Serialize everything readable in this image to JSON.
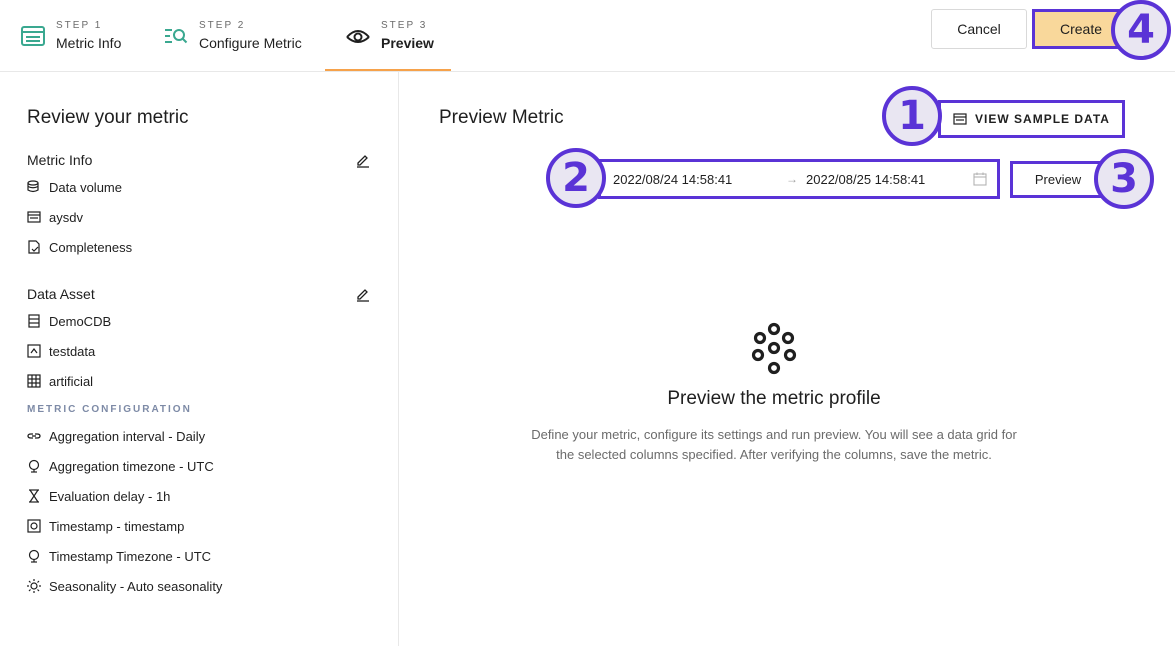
{
  "steps": [
    {
      "label": "STEP 1",
      "name": "Metric Info"
    },
    {
      "label": "STEP 2",
      "name": "Configure Metric"
    },
    {
      "label": "STEP 3",
      "name": "Preview"
    }
  ],
  "header": {
    "cancel_label": "Cancel",
    "create_label": "Create"
  },
  "left": {
    "title": "Review your metric",
    "metric_info": {
      "title": "Metric Info",
      "items": [
        "Data volume",
        "aysdv",
        "Completeness"
      ]
    },
    "data_asset": {
      "title": "Data Asset",
      "items": [
        "DemoCDB",
        "testdata",
        "artificial"
      ]
    },
    "config": {
      "title": "METRIC CONFIGURATION",
      "items": [
        "Aggregation interval - Daily",
        "Aggregation timezone - UTC",
        "Evaluation delay - 1h",
        "Timestamp - timestamp",
        "Timestamp Timezone - UTC",
        "Seasonality - Auto seasonality"
      ]
    }
  },
  "main": {
    "title": "Preview Metric",
    "sample_button": "VIEW SAMPLE DATA",
    "range": {
      "start": "2022/08/24 14:58:41",
      "separator": "→",
      "end": "2022/08/25 14:58:41"
    },
    "preview_button": "Preview",
    "empty_title": "Preview the metric profile",
    "empty_desc": "Define your metric, configure its settings and run preview. You will see a data grid for the selected columns specified. After verifying the columns, save the metric."
  },
  "badges": [
    "1",
    "2",
    "3",
    "4"
  ],
  "colors": {
    "accent": "#5a33d6",
    "active_tab": "#f6a24b",
    "create_bg": "#f9d89b",
    "step_icon": "#3aa890"
  }
}
